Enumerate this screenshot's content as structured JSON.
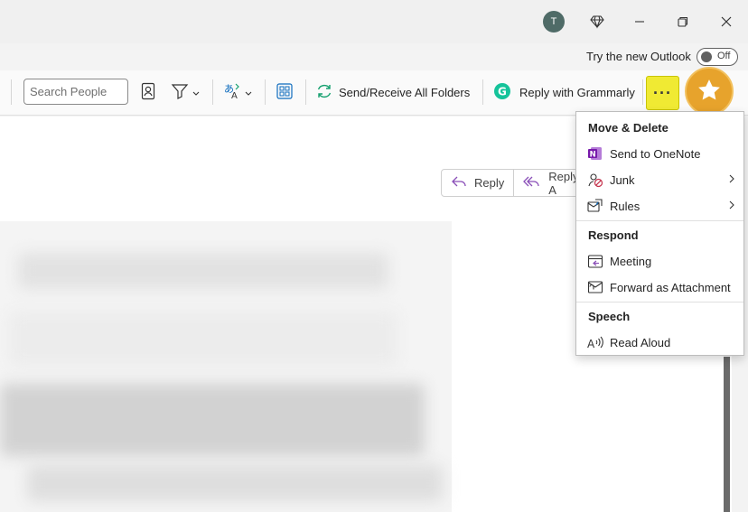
{
  "titlebar": {
    "avatar_initial": "T"
  },
  "try_new": {
    "label": "Try the new Outlook",
    "toggle_state": "Off"
  },
  "ribbon": {
    "search_placeholder": "Search People",
    "send_receive_label": "Send/Receive All Folders",
    "grammarly_label": "Reply with Grammarly",
    "more_label": "···"
  },
  "reading": {
    "reply_label": "Reply",
    "reply_all_label": "Reply A"
  },
  "menu": {
    "sections": [
      {
        "header": "Move & Delete",
        "items": [
          {
            "label": "Send to OneNote",
            "icon": "onenote-icon",
            "submenu": false
          },
          {
            "label": "Junk",
            "icon": "junk-icon",
            "submenu": true
          },
          {
            "label": "Rules",
            "icon": "rules-icon",
            "submenu": true
          }
        ]
      },
      {
        "header": "Respond",
        "items": [
          {
            "label": "Meeting",
            "icon": "meeting-icon",
            "submenu": false
          },
          {
            "label": "Forward as Attachment",
            "icon": "forward-attachment-icon",
            "submenu": false
          }
        ]
      },
      {
        "header": "Speech",
        "items": [
          {
            "label": "Read Aloud",
            "icon": "read-aloud-icon",
            "submenu": false
          }
        ]
      }
    ]
  },
  "colors": {
    "accent": "#0f6cbd",
    "highlight": "#f0ea33",
    "onenote": "#7719aa",
    "grammarly": "#15c39a",
    "badge": "#e7a32c"
  }
}
